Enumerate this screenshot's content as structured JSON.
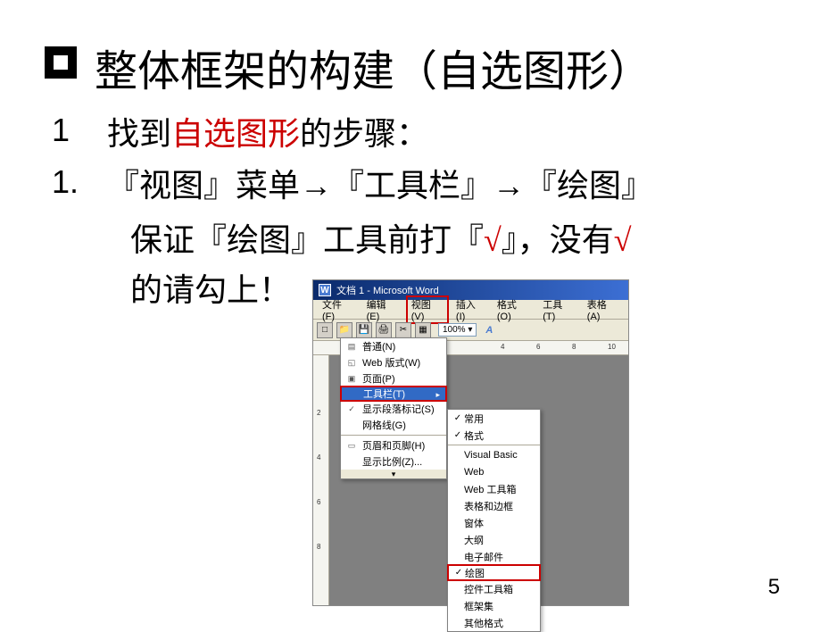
{
  "slide": {
    "heading": "整体框架的构建（自选图形）",
    "line1_num": "1",
    "line1_pre": "找到",
    "line1_red": "自选图形",
    "line1_post": "的步骤：",
    "line2_num": "1.",
    "step_view": "『视图』菜单",
    "step_toolbar": "『工具栏』",
    "step_draw": "『绘图』",
    "step_line2_a": "保证『绘图』工具前打『",
    "step_check": "√",
    "step_line2_b": "』，没有",
    "step_check2": "√",
    "step_line3": "的请勾上！",
    "page_number": "5"
  },
  "word": {
    "title": "文档 1 - Microsoft Word",
    "menus": {
      "file": "文件(F)",
      "edit": "编辑(E)",
      "view": "视图(V)",
      "insert": "插入(I)",
      "format": "格式(O)",
      "tools": "工具(T)",
      "table": "表格(A)"
    },
    "zoom": "100%",
    "ruler_marks": [
      "4",
      "6",
      "8",
      "10"
    ],
    "vruler_marks": [
      "2",
      "4",
      "6",
      "8"
    ],
    "view_menu": {
      "normal": "普通(N)",
      "weblayout": "Web 版式(W)",
      "pagelayout": "页面(P)",
      "toolbars": "工具栏(T)",
      "showmarks": "显示段落标记(S)",
      "gridlines": "网格线(G)",
      "headerfooter": "页眉和页脚(H)",
      "zoomratio": "显示比例(Z)..."
    },
    "toolbars_submenu": {
      "standard": "常用",
      "formatting": "格式",
      "vb": "Visual Basic",
      "web": "Web",
      "webtoolbox": "Web 工具箱",
      "tablesborders": "表格和边框",
      "window": "窗体",
      "outline": "大纲",
      "email": "电子邮件",
      "drawing": "绘图",
      "controltoolbox": "控件工具箱",
      "frames": "框架集",
      "otherformats": "其他格式"
    }
  }
}
